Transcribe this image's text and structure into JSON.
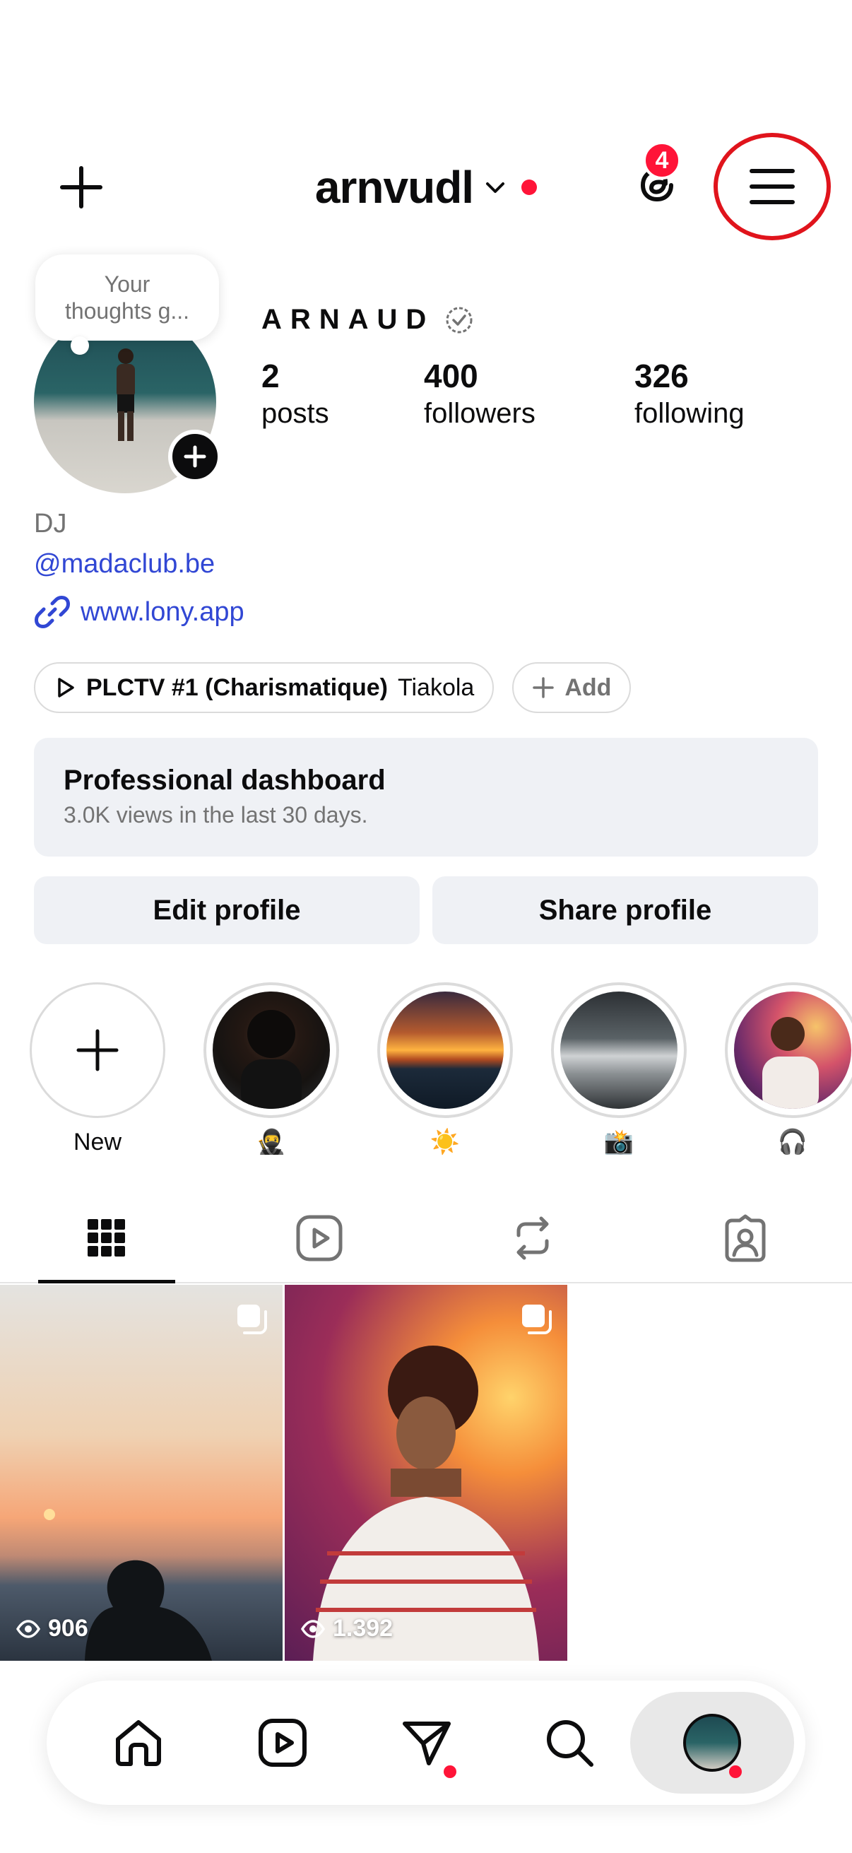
{
  "header": {
    "username": "arnvudl",
    "notification_count": "4"
  },
  "profile": {
    "thought_line1": "Your",
    "thought_line2": "thoughts g...",
    "display_name": "ARNAUD",
    "stats": [
      {
        "num": "2",
        "label": "posts"
      },
      {
        "num": "400",
        "label": "followers"
      },
      {
        "num": "326",
        "label": "following"
      }
    ],
    "category": "DJ",
    "mention": "@madaclub.be",
    "link": "www.lony.app"
  },
  "music": {
    "song": "PLCTV #1 (Charismatique)",
    "artist": "Tiakola",
    "add_label": "Add"
  },
  "dashboard": {
    "title": "Professional dashboard",
    "subtitle": "3.0K views in the last 30 days."
  },
  "actions": {
    "edit": "Edit profile",
    "share": "Share profile"
  },
  "highlights": [
    {
      "label": "New"
    },
    {
      "label": "🥷"
    },
    {
      "label": "☀️"
    },
    {
      "label": "📸"
    },
    {
      "label": "🎧"
    }
  ],
  "posts": [
    {
      "views": "906"
    },
    {
      "views": "1.392"
    }
  ],
  "colors": {
    "accent_red": "#ff1438",
    "link_blue": "#3147d4",
    "annotation_circle": "#e0141c"
  }
}
